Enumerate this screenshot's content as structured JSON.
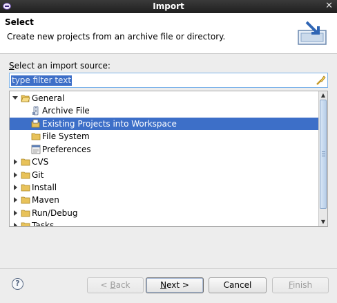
{
  "window": {
    "title": "Import",
    "close_glyph": "✕"
  },
  "header": {
    "title": "Select",
    "description": "Create new projects from an archive file or directory.",
    "icon": "import-wizard-icon"
  },
  "source_label": {
    "mnemonic": "S",
    "rest": "elect an import source:"
  },
  "filter": {
    "value": "type filter text"
  },
  "tree": {
    "rows": [
      {
        "label": "General",
        "expanded": true,
        "icon": "folder-open-icon"
      },
      {
        "label": "Archive File",
        "icon": "archive-file-icon"
      },
      {
        "label": "Existing Projects into Workspace",
        "icon": "existing-projects-icon",
        "selected": true
      },
      {
        "label": "File System",
        "icon": "folder-icon"
      },
      {
        "label": "Preferences",
        "icon": "preferences-icon"
      },
      {
        "label": "CVS",
        "expanded": false,
        "icon": "folder-icon"
      },
      {
        "label": "Git",
        "expanded": false,
        "icon": "folder-icon"
      },
      {
        "label": "Install",
        "expanded": false,
        "icon": "folder-icon"
      },
      {
        "label": "Maven",
        "expanded": false,
        "icon": "folder-icon"
      },
      {
        "label": "Run/Debug",
        "expanded": false,
        "icon": "folder-icon"
      },
      {
        "label": "Tasks",
        "expanded": false,
        "icon": "folder-icon"
      }
    ]
  },
  "buttons": {
    "back": {
      "mnemonic": "B",
      "before": "< ",
      "after": "ack",
      "enabled": false
    },
    "next": {
      "mnemonic": "N",
      "before": "",
      "after": "ext >",
      "enabled": true
    },
    "cancel": {
      "label": "Cancel",
      "enabled": true
    },
    "finish": {
      "mnemonic": "F",
      "before": "",
      "after": "inish",
      "enabled": false
    }
  },
  "colors": {
    "selection": "#3d6fc8",
    "folder": "#e8c25a",
    "title_bar": "#2a2a2a"
  }
}
